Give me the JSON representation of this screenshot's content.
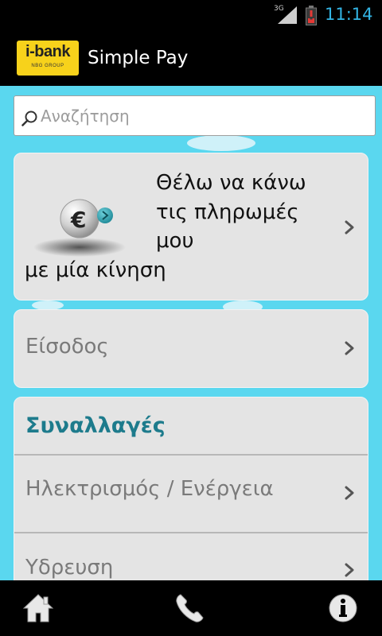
{
  "status_bar": {
    "network": "3G",
    "time": "11:14",
    "accent_color": "#33b5e5",
    "battery_color": "#e53935"
  },
  "app_bar": {
    "logo_text": "i-bank",
    "logo_subtext": "NBG GROUP",
    "title": "Simple Pay"
  },
  "search": {
    "placeholder": "Αναζήτηση",
    "value": ""
  },
  "promo": {
    "lines": [
      "Θέλω να κάνω",
      "τις πληρωμές",
      "μου",
      "με μία κίνηση"
    ],
    "icon": "euro-coin-icon"
  },
  "login": {
    "label": "Είσοδος"
  },
  "transactions": {
    "title": "Συναλλαγές",
    "items": [
      {
        "label": "Ηλεκτρισμός / Ενέργεια"
      },
      {
        "label": "Υδρευση"
      }
    ]
  },
  "bottom_nav": {
    "items": [
      {
        "name": "home",
        "icon": "home-icon"
      },
      {
        "name": "phone",
        "icon": "phone-icon"
      },
      {
        "name": "info",
        "icon": "info-icon"
      }
    ]
  },
  "colors": {
    "background": "#5ad7ef",
    "card": "#e4e4e4",
    "section_title": "#1d7b8c",
    "logo": "#f7d21b"
  }
}
